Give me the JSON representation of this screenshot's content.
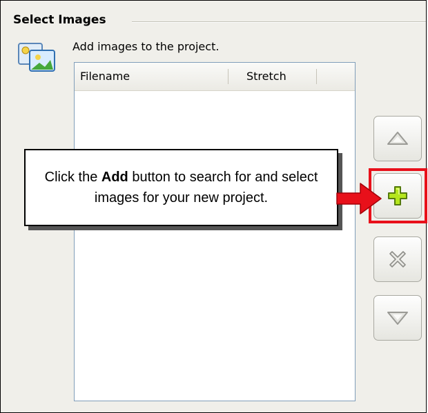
{
  "group": {
    "title": "Select Images"
  },
  "description": "Add images to the project.",
  "list": {
    "columns": [
      "Filename",
      "Stretch"
    ],
    "rows": []
  },
  "buttons": {
    "move_up": "arrow-up-icon",
    "add": "plus-icon",
    "remove": "x-icon",
    "move_down": "arrow-down-icon"
  },
  "callout": {
    "prefix": "Click the ",
    "bold": "Add",
    "suffix": " button to search for and select images for your new project."
  },
  "colors": {
    "highlight": "#e8101a",
    "plus_green": "#b5e61d",
    "arrow_red": "#e8101a"
  }
}
